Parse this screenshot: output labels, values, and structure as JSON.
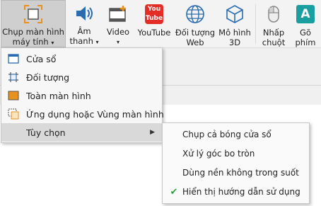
{
  "ribbon": {
    "buttons": [
      {
        "line1": "Chụp màn hình",
        "line2": "máy tính",
        "arrow": "▾",
        "icon": "screen-capture-icon"
      },
      {
        "line1": "Âm",
        "line2": "thanh",
        "arrow": "▾",
        "icon": "speaker-icon"
      },
      {
        "line1": "Video",
        "line2": "",
        "arrow": "▾",
        "icon": "video-icon"
      },
      {
        "line1": "YouTube",
        "line2": "",
        "arrow": "",
        "icon": "youtube-icon"
      },
      {
        "line1": "Đối tượng",
        "line2": "Web",
        "arrow": "",
        "icon": "globe-icon"
      },
      {
        "line1": "Mô hình",
        "line2": "3D",
        "arrow": "",
        "icon": "cube-icon"
      },
      {
        "line1": "Nhấp",
        "line2": "chuột",
        "arrow": "",
        "icon": "mouse-icon"
      },
      {
        "line1": "Gõ",
        "line2": "phím",
        "arrow": "",
        "icon": "keyboard-a-icon"
      }
    ],
    "youtube_logo_top": "You",
    "youtube_logo_bottom": "Tube",
    "keyboard_letter": "A"
  },
  "capture_menu": {
    "items": [
      {
        "label": "Cửa sổ",
        "icon": "window-icon"
      },
      {
        "label": "Đối tượng",
        "icon": "object-select-icon"
      },
      {
        "label": "Toàn màn hình",
        "icon": "fullscreen-icon"
      },
      {
        "label": "Ứng dụng hoặc Vùng màn hình",
        "icon": "app-region-icon"
      },
      {
        "label": "Tùy chọn",
        "submenu_arrow": "▶"
      }
    ]
  },
  "options_submenu": {
    "items": [
      {
        "label": "Chụp cả bóng cửa sổ",
        "checked": false
      },
      {
        "label": "Xử lý góc bo tròn",
        "checked": false
      },
      {
        "label": "Dùng nền không trong suốt",
        "checked": false
      },
      {
        "label": "Hiển thị hướng dẫn sử dụng",
        "checked": true,
        "check_mark": "✔"
      }
    ]
  },
  "colors": {
    "accent_orange": "#e8911c",
    "youtube_red": "#e52d27",
    "check_green": "#2e9d3f",
    "teal": "#1a9fa0",
    "blue": "#2b6cb0"
  }
}
